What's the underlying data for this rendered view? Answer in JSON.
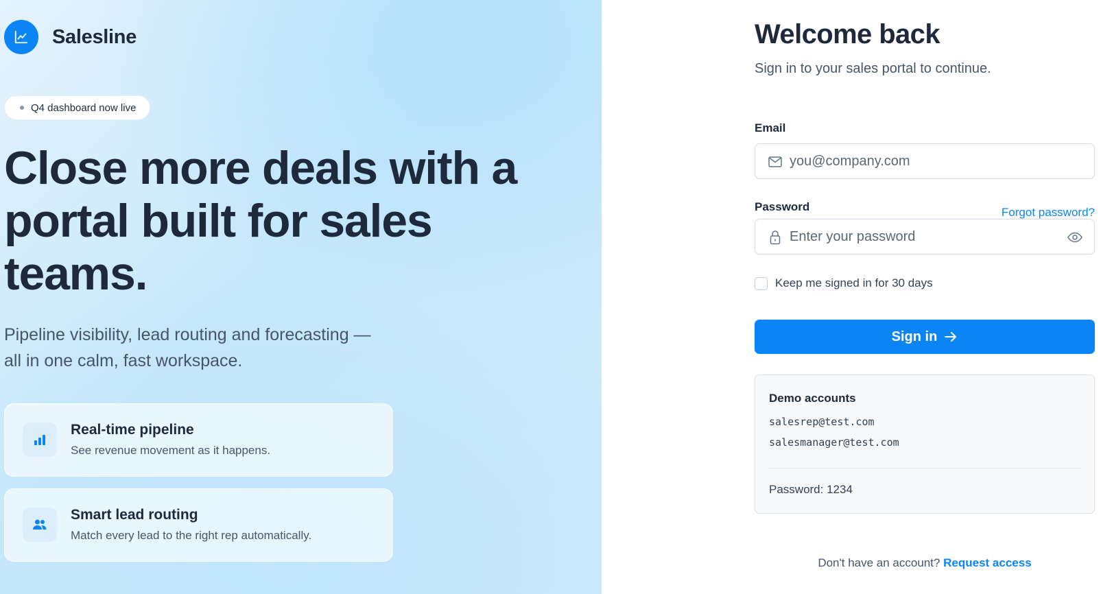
{
  "brand": {
    "name": "Salesline",
    "logo_icon": "trend-line-icon",
    "accent_color": "#0b84f5"
  },
  "hero": {
    "badge": "Q4 dashboard now live",
    "headline": "Close more deals with a portal built for sales teams.",
    "subheadline": "Pipeline visibility, lead routing and forecasting — all in one calm, fast workspace.",
    "features": [
      {
        "icon": "bar-chart-icon",
        "title": "Real-time pipeline",
        "description": "See revenue movement as it happens."
      },
      {
        "icon": "users-icon",
        "title": "Smart lead routing",
        "description": "Match every lead to the right rep automatically."
      }
    ]
  },
  "form": {
    "title": "Welcome back",
    "subtitle": "Sign in to your sales portal to continue.",
    "email": {
      "label": "Email",
      "placeholder": "you@company.com",
      "value": "",
      "icon": "mail-icon"
    },
    "password": {
      "label": "Password",
      "placeholder": "Enter your password",
      "value": "",
      "icon": "lock-icon",
      "toggle_icon": "eye-icon"
    },
    "forgot_link": "Forgot password?",
    "remember_label": "Keep me signed in for 30 days",
    "remember_checked": false,
    "submit_label": "Sign in",
    "submit_icon": "arrow-right-icon"
  },
  "demo": {
    "title": "Demo accounts",
    "accounts": [
      "salesrep@test.com",
      "salesmanager@test.com"
    ],
    "password_note": "Password: 1234"
  },
  "footer": {
    "prompt": "Don't have an account?",
    "link": "Request access"
  }
}
